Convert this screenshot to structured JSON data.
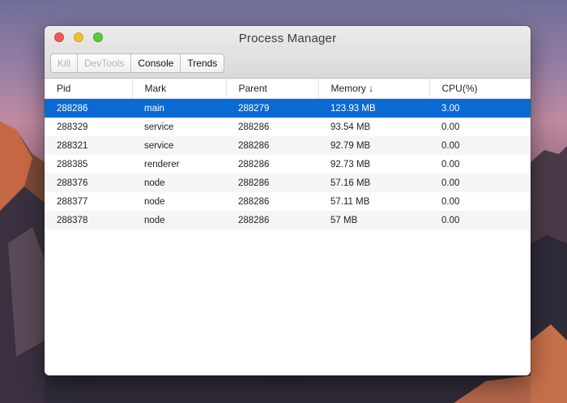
{
  "window": {
    "title": "Process Manager"
  },
  "toolbar": {
    "buttons": [
      {
        "label": "Kill",
        "enabled": false
      },
      {
        "label": "DevTools",
        "enabled": false
      },
      {
        "label": "Console",
        "enabled": true
      },
      {
        "label": "Trends",
        "enabled": true
      }
    ]
  },
  "table": {
    "columns": [
      "Pid",
      "Mark",
      "Parent",
      "Memory ↓",
      "CPU(%)"
    ],
    "rows": [
      {
        "pid": "288286",
        "mark": "main",
        "parent": "288279",
        "memory": "123.93 MB",
        "cpu": "3.00",
        "selected": true
      },
      {
        "pid": "288329",
        "mark": "service",
        "parent": "288286",
        "memory": "93.54 MB",
        "cpu": "0.00"
      },
      {
        "pid": "288321",
        "mark": "service",
        "parent": "288286",
        "memory": "92.79 MB",
        "cpu": "0.00"
      },
      {
        "pid": "288385",
        "mark": "renderer",
        "parent": "288286",
        "memory": "92.73 MB",
        "cpu": "0.00"
      },
      {
        "pid": "288376",
        "mark": "node",
        "parent": "288286",
        "memory": "57.16 MB",
        "cpu": "0.00"
      },
      {
        "pid": "288377",
        "mark": "node",
        "parent": "288286",
        "memory": "57.11 MB",
        "cpu": "0.00"
      },
      {
        "pid": "288378",
        "mark": "node",
        "parent": "288286",
        "memory": "57 MB",
        "cpu": "0.00"
      }
    ]
  },
  "colors": {
    "selection": "#0a6ad4",
    "close": "#ee5c55",
    "minimize": "#f4bd30",
    "maximize": "#5cc83e"
  }
}
